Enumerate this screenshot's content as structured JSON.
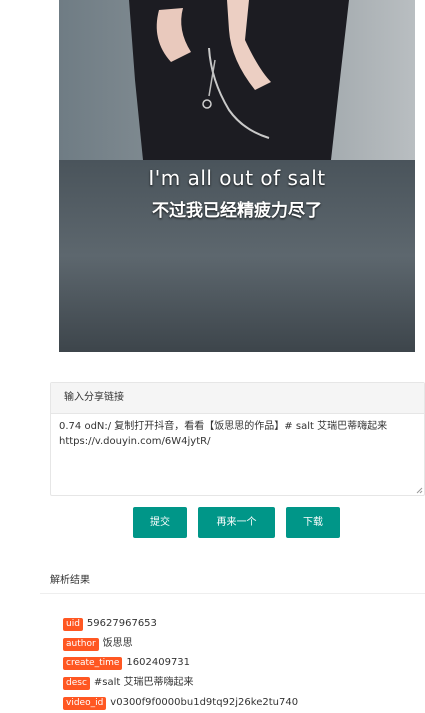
{
  "video": {
    "subtitle_en": "I'm all out of salt",
    "subtitle_zh": "不过我已经精疲力尽了"
  },
  "share_panel": {
    "header": "输入分享链接",
    "text": "0.74 odN:/ 复制打开抖音，看看【饭思思的作品】# salt 艾瑞巴蒂嗨起来 https://v.douyin.com/6W4jytR/"
  },
  "buttons": {
    "submit": "提交",
    "again": "再来一个",
    "download": "下载"
  },
  "colors": {
    "button": "#009688",
    "badge": "#ff5722"
  },
  "results": {
    "title": "解析结果",
    "rows": [
      {
        "key": "uid",
        "value": "59627967653"
      },
      {
        "key": "author",
        "value": "饭思思"
      },
      {
        "key": "create_time",
        "value": "1602409731"
      },
      {
        "key": "desc",
        "value": "#salt 艾瑞巴蒂嗨起来"
      },
      {
        "key": "video_id",
        "value": "v0300f9f0000bu1d9tq92j26ke2tu740"
      }
    ]
  }
}
